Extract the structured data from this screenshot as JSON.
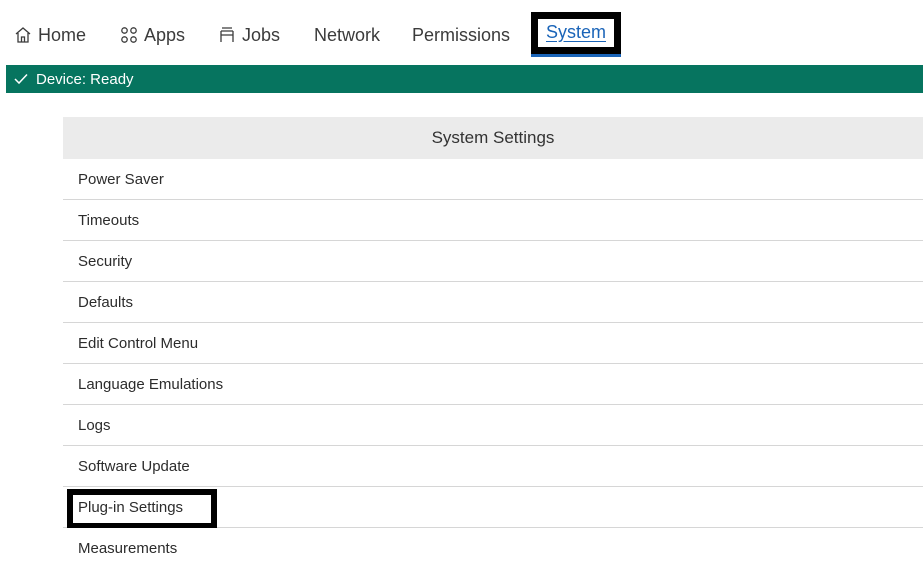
{
  "nav": {
    "items": [
      {
        "label": "Home",
        "icon": "home-icon"
      },
      {
        "label": "Apps",
        "icon": "apps-icon"
      },
      {
        "label": "Jobs",
        "icon": "jobs-icon"
      },
      {
        "label": "Network"
      },
      {
        "label": "Permissions"
      },
      {
        "label": "System",
        "active": true
      }
    ],
    "active_color": "#1a64b8"
  },
  "status": {
    "icon": "check-icon",
    "text": "Device: Ready",
    "color": "#06745f"
  },
  "panel": {
    "title": "System Settings",
    "items": [
      "Power Saver",
      "Timeouts",
      "Security",
      "Defaults",
      "Edit Control Menu",
      "Language Emulations",
      "Logs",
      "Software Update",
      "Plug-in Settings",
      "Measurements"
    ],
    "highlighted_item": "Plug-in Settings"
  }
}
